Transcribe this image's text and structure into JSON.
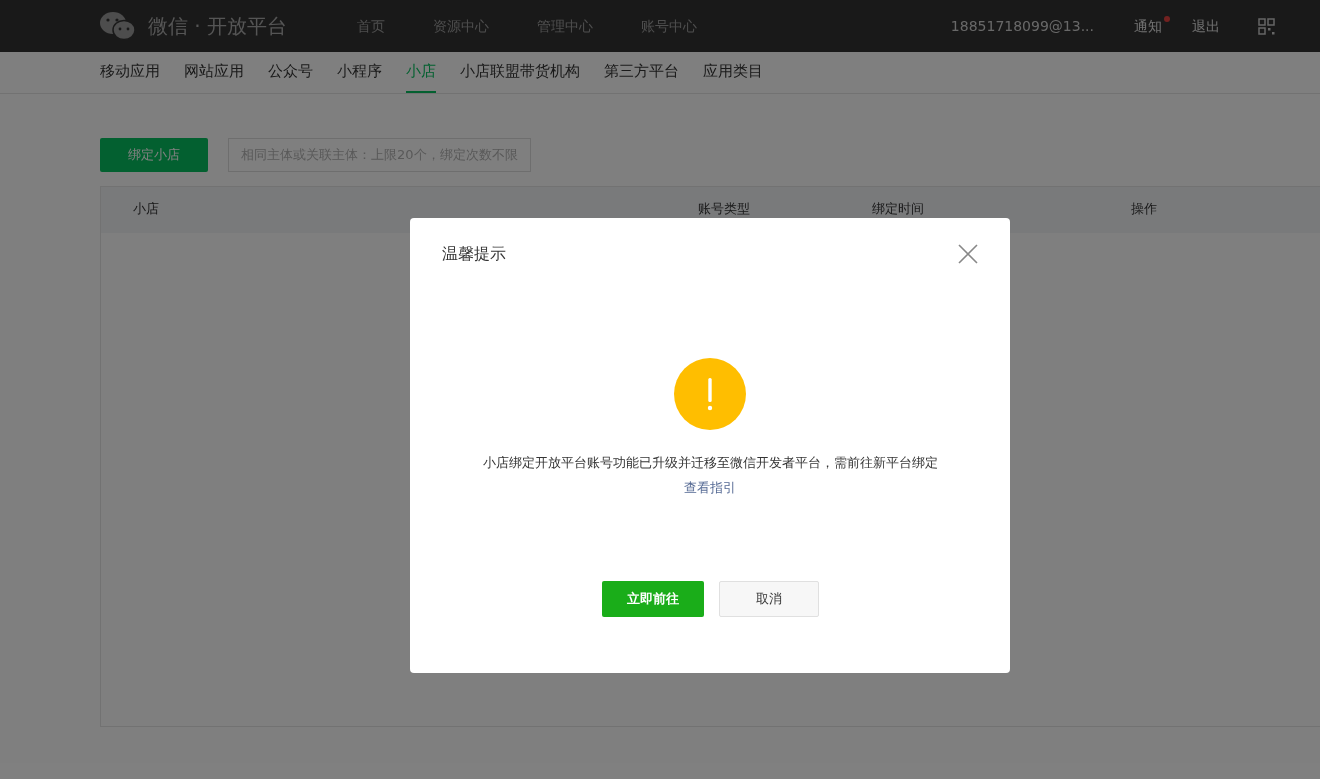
{
  "header": {
    "logo_text": "微信 · 开放平台",
    "nav": [
      "首页",
      "资源中心",
      "管理中心",
      "账号中心"
    ],
    "account": "18851718099@13...",
    "notice": {
      "label": "通知",
      "unread": true
    },
    "logout": "退出"
  },
  "tabs": [
    {
      "label": "移动应用",
      "selected": false
    },
    {
      "label": "网站应用",
      "selected": false
    },
    {
      "label": "公众号",
      "selected": false
    },
    {
      "label": "小程序",
      "selected": false
    },
    {
      "label": "小店",
      "selected": true
    },
    {
      "label": "小店联盟带货机构",
      "selected": false
    },
    {
      "label": "第三方平台",
      "selected": false
    },
    {
      "label": "应用类目",
      "selected": false
    }
  ],
  "bind_button": "绑定小店",
  "bind_tip": "相同主体或关联主体：上限20个，绑定次数不限",
  "table": {
    "columns": [
      "小店",
      "账号类型",
      "绑定时间",
      "操作"
    ]
  },
  "dialog": {
    "title": "温馨提示",
    "message": "小店绑定开放平台账号功能已升级并迁移至微信开发者平台，需前往新平台绑定",
    "link": "查看指引",
    "buttons": [
      {
        "label": "立即前往",
        "kind": "primary"
      },
      {
        "label": "取消",
        "kind": "default"
      }
    ]
  }
}
